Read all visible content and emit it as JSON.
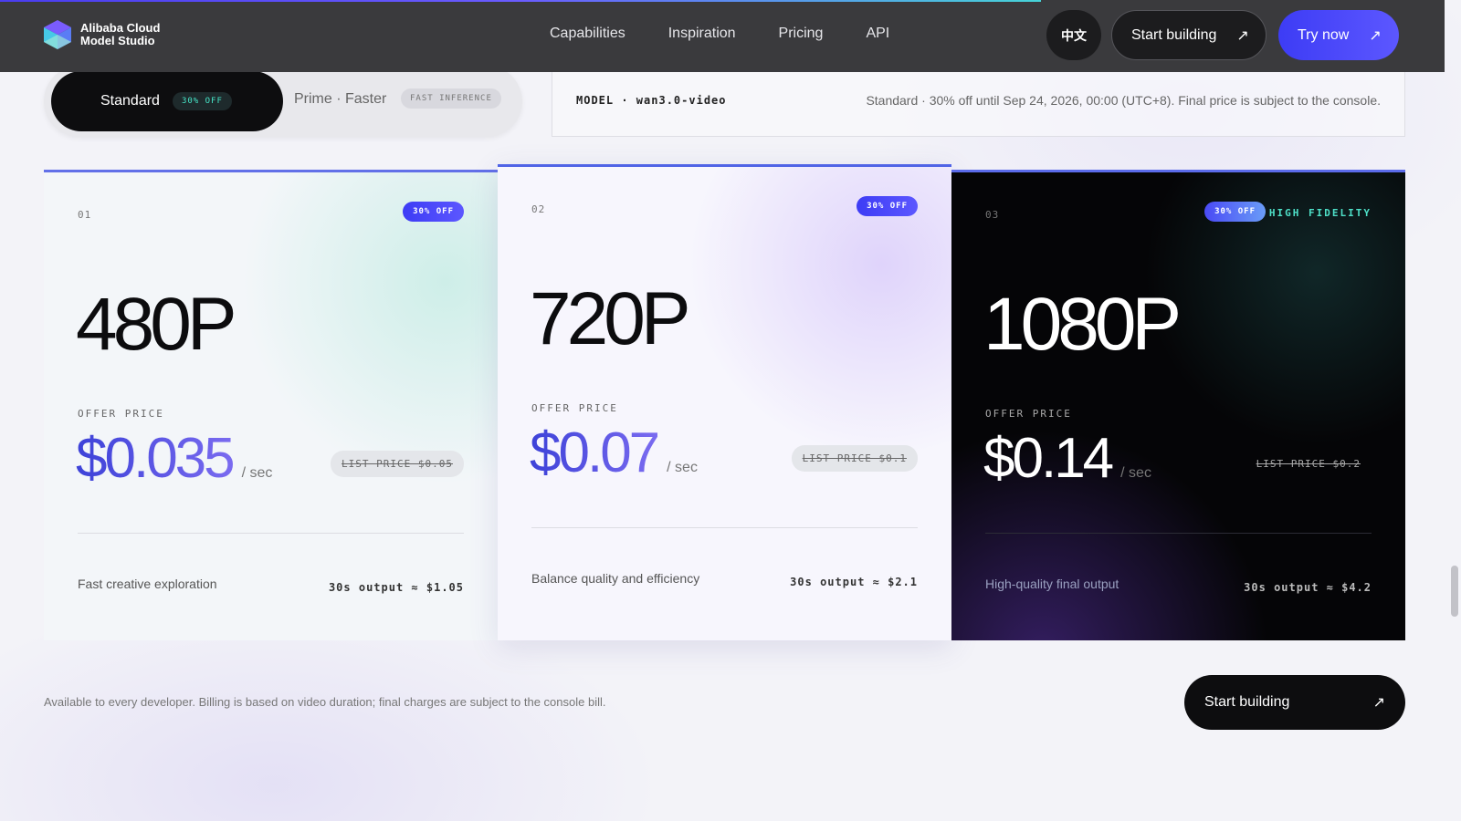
{
  "colors": {
    "nav_bg": "#3a3a3d",
    "accent": "#3d3cf5",
    "teal": "#46e6c8",
    "dark_card": "#050507"
  },
  "nav": {
    "logo_line1": "Alibaba Cloud",
    "logo_line2": "Model Studio",
    "links": [
      "Capabilities",
      "Inspiration",
      "Pricing",
      "API"
    ],
    "lang": "中文",
    "start_label": "Start building",
    "try_label": "Try now",
    "arrow_icon": "arrow-up-right-icon"
  },
  "toggle": {
    "standard_label": "Standard",
    "standard_badge": "30% OFF",
    "prime_label": "Prime · Faster",
    "prime_badge": "FAST INFERENCE"
  },
  "model": {
    "label": "MODEL · wan3.0-video",
    "note": "Standard · 30% off until Sep 24, 2026, 00:00 (UTC+8). Final price is subject to the console."
  },
  "cards": [
    {
      "num": "01",
      "badge": "30% OFF",
      "resolution": "480P",
      "offer_label": "OFFER PRICE",
      "price": "$0.035",
      "unit": "/ sec",
      "list_price": "LIST PRICE $0.05",
      "desc": "Fast creative exploration",
      "output": "30s output ≈ $1.05"
    },
    {
      "num": "02",
      "badge": "30% OFF",
      "resolution": "720P",
      "offer_label": "OFFER PRICE",
      "price": "$0.07",
      "unit": "/ sec",
      "list_price": "LIST PRICE $0.1",
      "desc": "Balance quality and efficiency",
      "output": "30s output ≈ $2.1"
    },
    {
      "num": "03",
      "badge": "30% OFF",
      "extra_label": "HIGH FIDELITY",
      "resolution": "1080P",
      "offer_label": "OFFER PRICE",
      "price": "$0.14",
      "unit": "/ sec",
      "list_price": "LIST PRICE $0.2",
      "desc": "High-quality final output",
      "output": "30s output ≈ $4.2"
    }
  ],
  "footer": {
    "note": "Available to every developer. Billing is based on video duration; final charges are subject to the console bill.",
    "start_label": "Start building"
  }
}
